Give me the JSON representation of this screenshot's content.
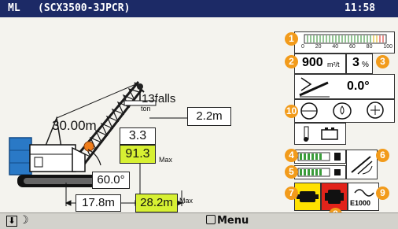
{
  "header": {
    "mode": "ML",
    "model": "(SCX3500-3JPCR)",
    "time": "11:58"
  },
  "crane": {
    "boom_length": "30.00m",
    "falls": "13falls",
    "hook_height": "2.2m",
    "ton_unit": "ton",
    "actual_load": "3.3",
    "rated_load": "91.3",
    "max_label_load": "Max",
    "boom_angle": "60.0°",
    "working_radius": "17.8m",
    "max_radius": "28.2m",
    "max_label_radius": "Max"
  },
  "indicators": {
    "load_ratio_scale": [
      "0",
      "20",
      "40",
      "60",
      "80",
      "100"
    ],
    "wind_area": "900",
    "wind_unit": "m²/t",
    "slope": "3",
    "slope_unit": "%",
    "tilt_angle": "0.0°",
    "badges": [
      "1",
      "2",
      "3",
      "4",
      "5",
      "6",
      "7",
      "8",
      "9",
      "10"
    ],
    "engine_code": "E1000"
  },
  "footer": {
    "menu_label": "Menu"
  },
  "colors": {
    "title_bar": "#1c2a66",
    "highlight": "#d7f033",
    "alarm_red": "#e2231a",
    "accent_yellow": "#ffe100",
    "badge": "#f29b1b"
  },
  "icons": [
    "winch-icon",
    "brake-icon",
    "hydraulic-oil-icon",
    "engine-warning-icon",
    "wiper-icon",
    "fuel-icon",
    "battery-icon",
    "temperature-icon",
    "oil-pressure-icon",
    "boom-tilt-icon",
    "night-mode-icon",
    "scroll-down-icon"
  ]
}
